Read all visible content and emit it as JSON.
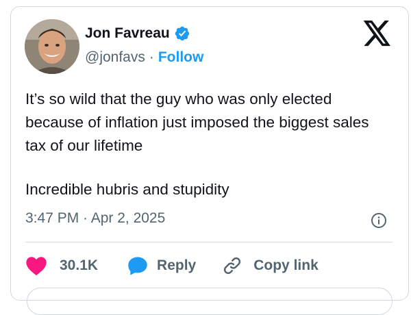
{
  "author": {
    "name": "Jon Favreau",
    "handle": "@jonfavs",
    "separator": "·",
    "follow_label": "Follow",
    "verified": true
  },
  "tweet": {
    "paragraphs": [
      "It’s so wild that the guy who was only elected because of inflation just imposed the biggest sales tax of our lifetime",
      "Incredible hubris and stupidity"
    ],
    "timestamp": "3:47 PM · Apr 2, 2025"
  },
  "actions": {
    "like_count": "30.1K",
    "reply_label": "Reply",
    "copy_link_label": "Copy link"
  },
  "colors": {
    "accent": "#1d9bf0",
    "like": "#f91880",
    "text": "#0f1419",
    "secondary": "#536471",
    "border": "#cfd9de"
  },
  "icons": [
    "verified-badge-icon",
    "x-logo-icon",
    "info-icon",
    "heart-icon",
    "reply-bubble-icon",
    "link-icon"
  ]
}
